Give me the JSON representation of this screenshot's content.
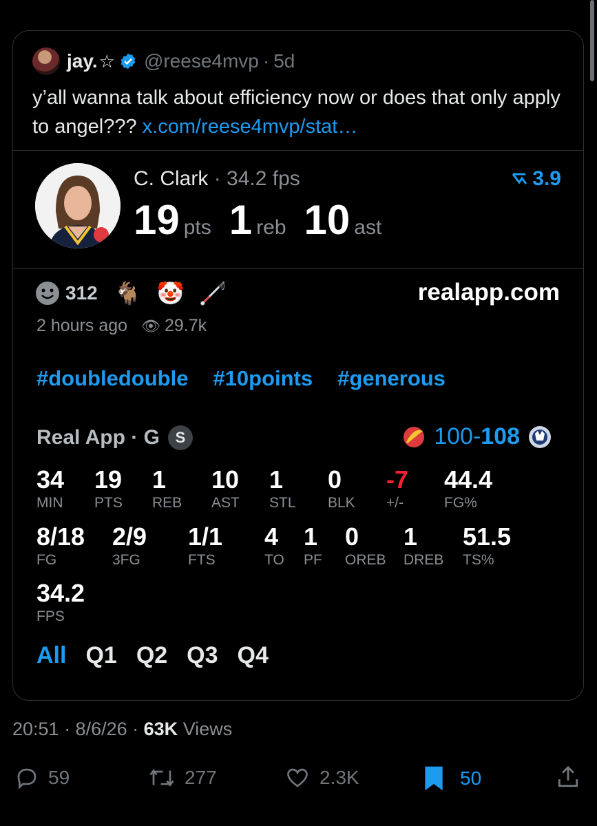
{
  "quoted": {
    "name": "jay.",
    "star": "☆",
    "handle": "@reese4mvp",
    "sep": "·",
    "age": "5d",
    "text": "y’all wanna talk about efficiency now or does that only apply to angel???",
    "link": "x.com/reese4mvp/stat…"
  },
  "player": {
    "name": "C. Clark",
    "sep": "·",
    "fps": "34.2 fps",
    "trend": "3.9",
    "pts": "19",
    "pts_label": "pts",
    "reb": "1",
    "reb_label": "reb",
    "ast": "10",
    "ast_label": "ast"
  },
  "reactions": {
    "count": "312",
    "emojis": [
      "🐐",
      "🤡",
      "🦯"
    ],
    "site": "realapp.com",
    "time": "2 hours ago",
    "views": "29.7k"
  },
  "hashtags": [
    "#doubledouble",
    "#10points",
    "#generous"
  ],
  "game": {
    "source": "Real App · G",
    "badge": "S",
    "score_home": "100",
    "score_dash": "-",
    "score_away": "108"
  },
  "stats": [
    {
      "v": "34",
      "k": "MIN"
    },
    {
      "v": "19",
      "k": "PTS"
    },
    {
      "v": "1",
      "k": "REB"
    },
    {
      "v": "10",
      "k": "AST"
    },
    {
      "v": "1",
      "k": "STL"
    },
    {
      "v": "0",
      "k": "BLK"
    },
    {
      "v": "-7",
      "k": "+/-"
    },
    {
      "v": "44.4",
      "k": "FG%"
    },
    {
      "v": "8/18",
      "k": "FG"
    },
    {
      "v": "2/9",
      "k": "3FG"
    },
    {
      "v": "1/1",
      "k": "FTS"
    },
    {
      "v": "4",
      "k": "TO"
    },
    {
      "v": "1",
      "k": "PF"
    },
    {
      "v": "0",
      "k": "OREB"
    },
    {
      "v": "1",
      "k": "DREB"
    },
    {
      "v": "51.5",
      "k": "TS%"
    },
    {
      "v": "34.2",
      "k": "FPS"
    }
  ],
  "quarters": [
    "All",
    "Q1",
    "Q2",
    "Q3",
    "Q4"
  ],
  "tweet": {
    "time": "20:51 · 8/6/26 ·",
    "views_num": "63K",
    "views_label": "Views",
    "replies": "59",
    "reposts": "277",
    "likes": "2.3K",
    "bookmarks": "50"
  },
  "colors": {
    "accent": "#1d9bf0",
    "negative": "#f4212e",
    "background": "#000000"
  }
}
